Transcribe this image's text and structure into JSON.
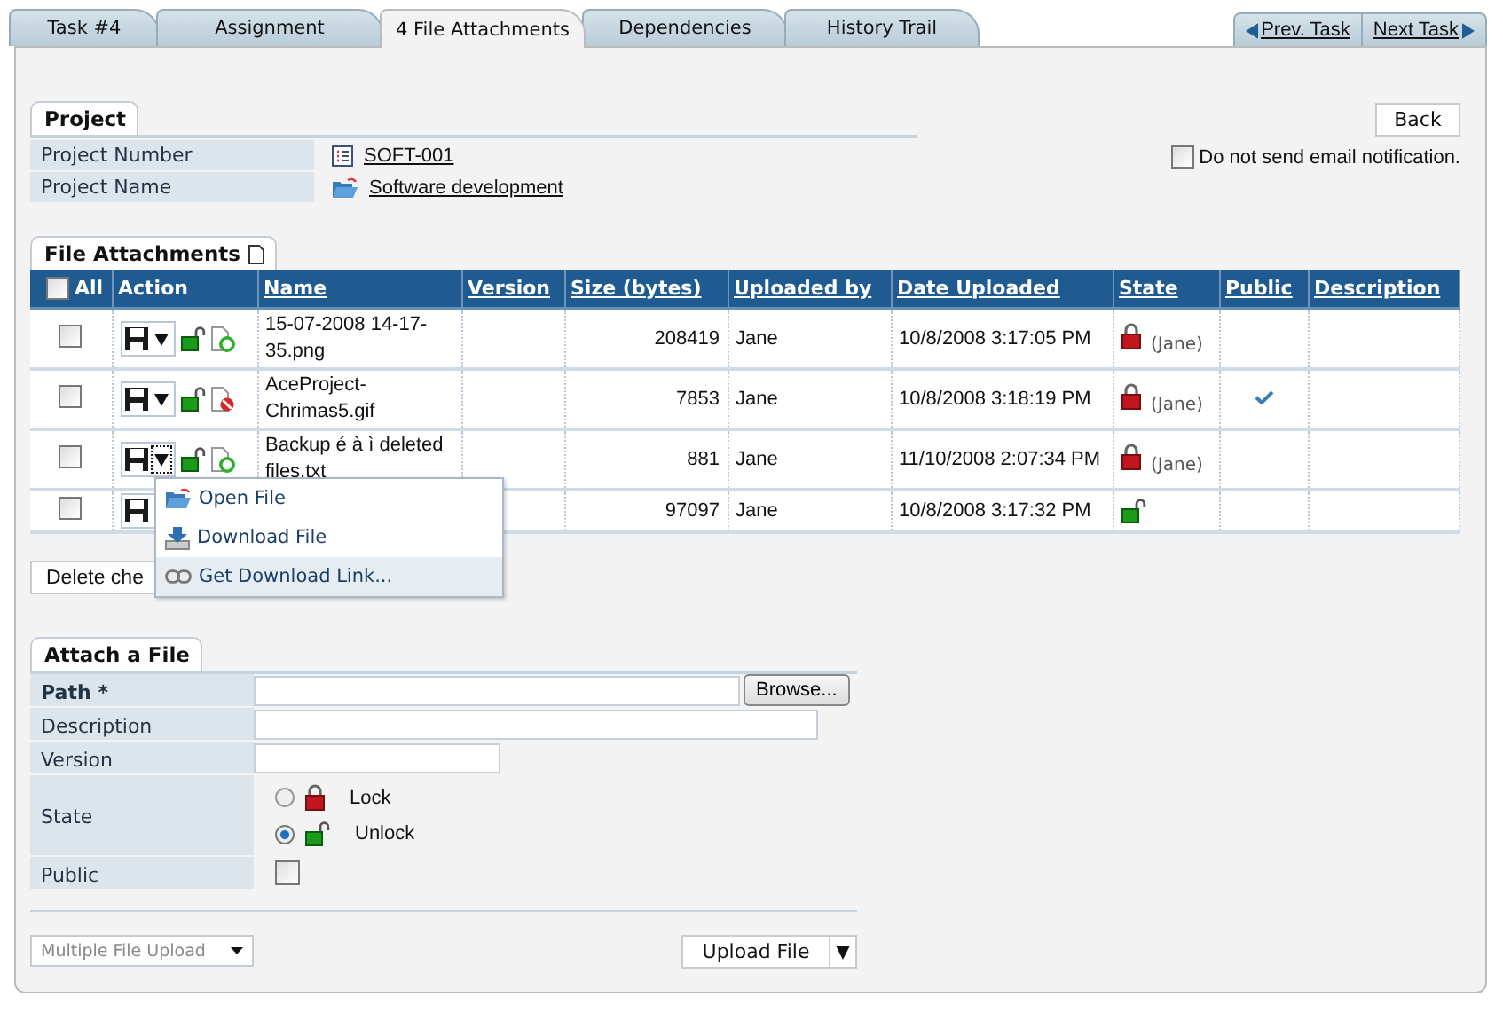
{
  "tabs": [
    {
      "label": "Task #4",
      "selected": false
    },
    {
      "label": "Assignment",
      "selected": false
    },
    {
      "label": "4 File Attachments",
      "selected": true
    },
    {
      "label": "Dependencies",
      "selected": false
    },
    {
      "label": "History Trail",
      "selected": false
    }
  ],
  "nav": {
    "prev": "Prev. Task",
    "next": "Next Task"
  },
  "project": {
    "title": "Project",
    "fields": [
      {
        "label": "Project Number",
        "value": "SOFT-001",
        "kind": "number"
      },
      {
        "label": "Project Name",
        "value": "Software development",
        "kind": "name"
      }
    ]
  },
  "back_button": "Back",
  "email_option": {
    "label": "Do not send email notification.",
    "checked": false
  },
  "attachments": {
    "title": "File Attachments",
    "columns": [
      "All",
      "Action",
      "Name",
      "Version",
      "Size (bytes)",
      "Uploaded by",
      "Date Uploaded",
      "State",
      "Public",
      "Description"
    ],
    "all_checked": false,
    "rows": [
      {
        "checked": false,
        "file_blocked": false,
        "menu_open": false,
        "name": "15-07-2008 14-17-35.png",
        "size": "208419",
        "uploaded_by": "Jane",
        "date": "10/8/2008 3:17:05 PM",
        "locked": true,
        "lock_owner": "(Jane)",
        "public": false
      },
      {
        "checked": false,
        "file_blocked": true,
        "menu_open": false,
        "name": "AceProject-Chrimas5.gif",
        "size": "7853",
        "uploaded_by": "Jane",
        "date": "10/8/2008 3:18:19 PM",
        "locked": true,
        "lock_owner": "(Jane)",
        "public": true
      },
      {
        "checked": false,
        "file_blocked": false,
        "menu_open": true,
        "name": "Backup é à ì deleted files.txt",
        "size": "881",
        "uploaded_by": "Jane",
        "date": "11/10/2008 2:07:34 PM",
        "locked": true,
        "lock_owner": "(Jane)",
        "public": false
      },
      {
        "checked": false,
        "menu_open": false,
        "size": "97097",
        "uploaded_by": "Jane",
        "date": "10/8/2008 3:17:32 PM",
        "locked": false,
        "public": false
      }
    ],
    "delete_button": "Delete che"
  },
  "context_menu": {
    "items": [
      {
        "label": "Open File",
        "kind": "open",
        "selected": false
      },
      {
        "label": "Download File",
        "kind": "download",
        "selected": false
      },
      {
        "label": "Get Download Link...",
        "kind": "link",
        "selected": true
      }
    ]
  },
  "attach": {
    "title": "Attach a File",
    "path_label": "Path",
    "required_mark": "*",
    "browse_button": "Browse...",
    "description_label": "Description",
    "version_label": "Version",
    "state_label": "State",
    "state_options": [
      {
        "label": "Lock",
        "kind": "locked",
        "selected": false
      },
      {
        "label": "Unlock",
        "kind": "unlocked",
        "selected": true
      }
    ],
    "public_label": "Public",
    "public_checked": false,
    "multi_upload": "Multiple File Upload",
    "upload_button": "Upload File"
  }
}
